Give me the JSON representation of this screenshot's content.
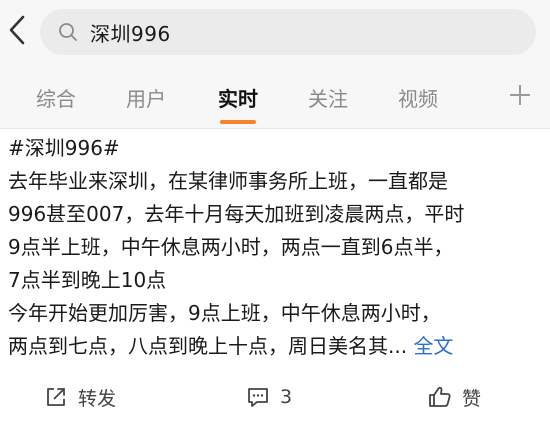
{
  "header": {
    "back_icon": "chevron-left-icon",
    "search_icon": "search-icon",
    "search_value": "深圳996"
  },
  "tabs": [
    {
      "label": "综合",
      "active": false
    },
    {
      "label": "用户",
      "active": false
    },
    {
      "label": "实时",
      "active": true
    },
    {
      "label": "关注",
      "active": false
    },
    {
      "label": "视频",
      "active": false
    }
  ],
  "tabs_accent_color": "#f5842a",
  "plus_icon": "plus-icon",
  "post": {
    "hashtag": "#深圳996#",
    "lines": [
      "去年毕业来深圳，在某律师事务所上班，一直都是",
      "996甚至007，去年十月每天加班到凌晨两点，平时",
      "9点半上班，中午休息两小时，两点一直到6点半，",
      "7点半到晚上10点",
      "今年开始更加厉害，9点上班，中午休息两小时，"
    ],
    "last_line": "两点到七点，八点到晚上十点，周日美名其...",
    "more_label": "全文",
    "link_color": "#2a6fc9"
  },
  "actions": {
    "repost": {
      "icon": "share-icon",
      "label": "转发"
    },
    "comment": {
      "icon": "comment-icon",
      "label": "3"
    },
    "like": {
      "icon": "thumbs-up-icon",
      "label": "赞"
    }
  }
}
